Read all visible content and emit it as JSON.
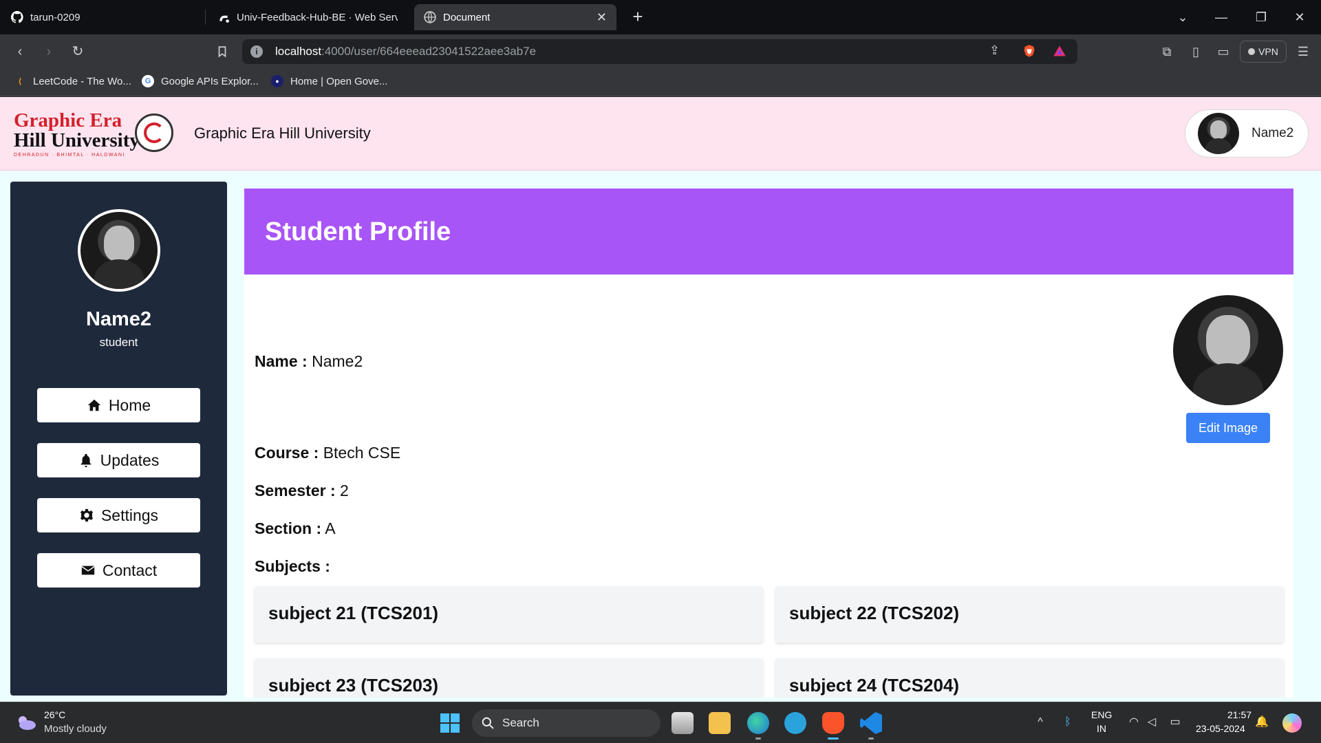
{
  "browser": {
    "tabs": [
      {
        "title": "tarun-0209",
        "icon": "github-icon"
      },
      {
        "title": "Univ-Feedback-Hub-BE · Web Servic",
        "icon": "render-icon"
      },
      {
        "title": "Document",
        "icon": "globe-icon",
        "active": true
      }
    ],
    "url_host": "localhost",
    "url_rest": ":4000/user/664eeead23041522aee3ab7e",
    "vpn_label": "VPN",
    "bookmarks": [
      {
        "label": "LeetCode - The Wo...",
        "icon": "leetcode-icon"
      },
      {
        "label": "Google APIs Explor...",
        "icon": "google-icon"
      },
      {
        "label": "Home | Open Gove...",
        "icon": "opengov-icon"
      }
    ]
  },
  "header": {
    "logo_line1": "Graphic Era",
    "logo_line2": "Hill University",
    "logo_line3": "DEHRADUN · BHIMTAL · HALDWANI",
    "title": "Graphic Era Hill University",
    "user_name": "Name2"
  },
  "sidebar": {
    "name": "Name2",
    "role": "student",
    "items": [
      {
        "label": "Home",
        "icon": "home-icon"
      },
      {
        "label": "Updates",
        "icon": "bell-icon"
      },
      {
        "label": "Settings",
        "icon": "gear-icon"
      },
      {
        "label": "Contact",
        "icon": "envelope-icon"
      }
    ]
  },
  "profile": {
    "title": "Student Profile",
    "name_label": "Name :",
    "name_value": "Name2",
    "course_label": "Course :",
    "course_value": "Btech CSE",
    "semester_label": "Semester :",
    "semester_value": "2",
    "section_label": "Section :",
    "section_value": "A",
    "subjects_label": "Subjects :",
    "edit_image_label": "Edit Image",
    "subjects": [
      "subject 21 (TCS201)",
      "subject 22 (TCS202)",
      "subject 23 (TCS203)",
      "subject 24 (TCS204)"
    ]
  },
  "colors": {
    "banner": "#a855f7",
    "sidebar": "#1e293b",
    "header_bg": "#fde4ee",
    "edit_button": "#3b82f6"
  },
  "taskbar": {
    "temperature": "26°C",
    "weather": "Mostly cloudy",
    "search_placeholder": "Search",
    "lang_line1": "ENG",
    "lang_line2": "IN",
    "time": "21:57",
    "date": "23-05-2024"
  }
}
